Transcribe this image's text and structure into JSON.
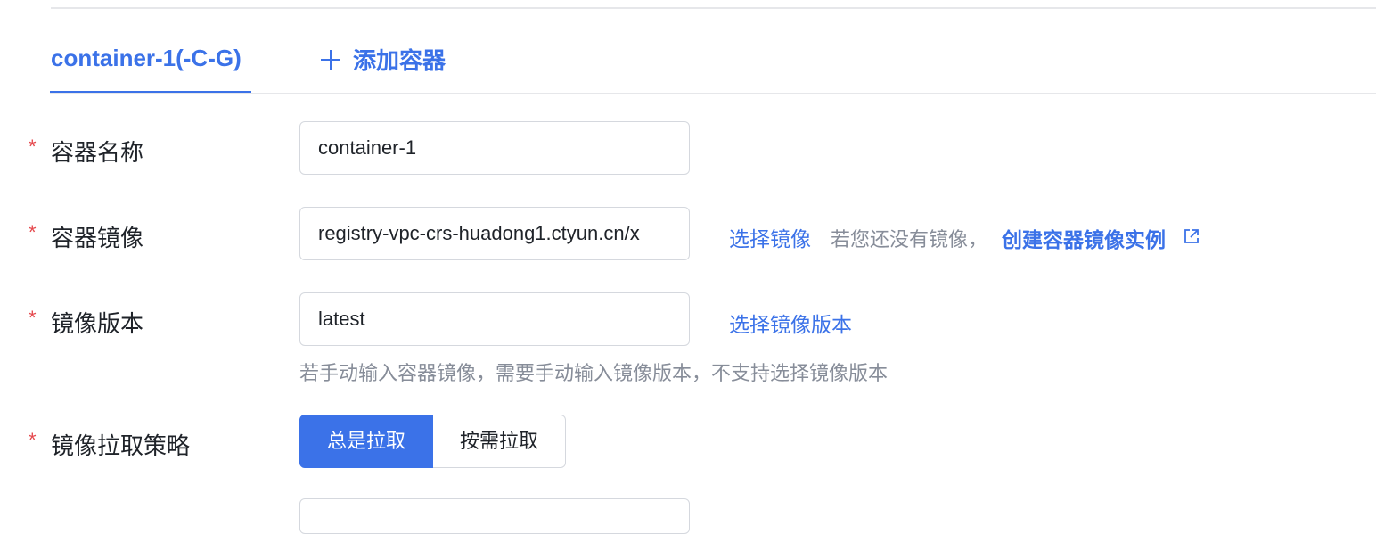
{
  "tabs": {
    "active_label": "container-1(-C-G)",
    "add_label": "添加容器"
  },
  "form": {
    "required_mark": "*",
    "container_name": {
      "label": "容器名称",
      "value": "container-1"
    },
    "container_image": {
      "label": "容器镜像",
      "value": "registry-vpc-crs-huadong1.ctyun.cn/x",
      "select_link": "选择镜像",
      "hint": "若您还没有镜像，",
      "create_link": "创建容器镜像实例"
    },
    "image_version": {
      "label": "镜像版本",
      "value": "latest",
      "select_link": "选择镜像版本",
      "help_text": "若手动输入容器镜像，需要手动输入镜像版本，不支持选择镜像版本"
    },
    "pull_policy": {
      "label": "镜像拉取策略",
      "options": [
        "总是拉取",
        "按需拉取"
      ],
      "selected": "总是拉取"
    }
  },
  "colors": {
    "accent": "#3b72e8",
    "required": "#e5484d",
    "border": "#d5d8de",
    "muted_text": "#878d99"
  }
}
